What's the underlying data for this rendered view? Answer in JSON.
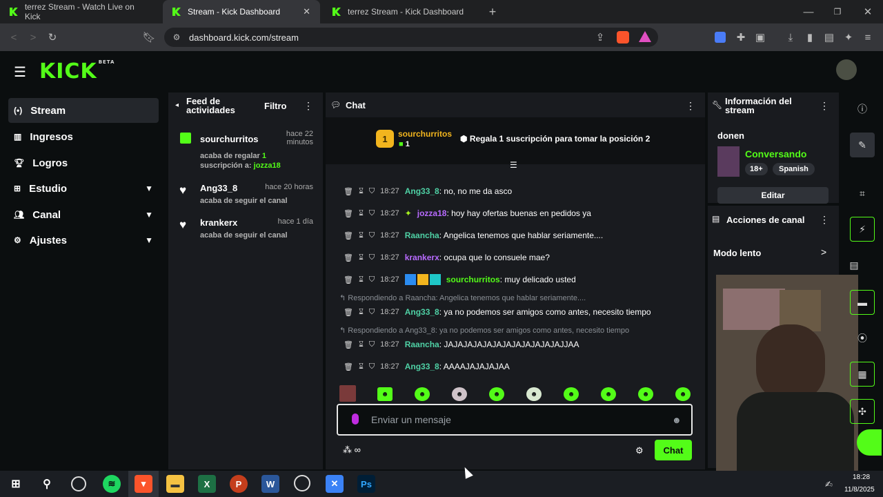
{
  "browser": {
    "tabs": [
      {
        "title": "terrez Stream - Watch Live on Kick"
      },
      {
        "title": "Stream - Kick Dashboard"
      },
      {
        "title": "terrez Stream - Kick Dashboard"
      }
    ],
    "url": "dashboard.kick.com/stream"
  },
  "app": {
    "logo": "KICK",
    "logo_badge": "BETA"
  },
  "sidebar": {
    "items": [
      {
        "label": "Stream",
        "icon": "broadcast-icon"
      },
      {
        "label": "Ingresos",
        "icon": "chart-icon"
      },
      {
        "label": "Logros",
        "icon": "trophy-icon"
      },
      {
        "label": "Estudio",
        "icon": "studio-icon"
      },
      {
        "label": "Canal",
        "icon": "users-icon"
      },
      {
        "label": "Ajustes",
        "icon": "gear-icon"
      }
    ]
  },
  "feed": {
    "title": "Feed de actividades",
    "filter": "Filtro",
    "items": [
      {
        "user": "sourchurritos",
        "time": "hace 22 minutos",
        "text": "acaba de regalar",
        "count": "1",
        "text2": "suscripción a:",
        "target": "jozza18"
      },
      {
        "user": "Ang33_8",
        "time": "hace 20 horas",
        "text": "acaba de seguir el canal"
      },
      {
        "user": "krankerx",
        "time": "hace 1 día",
        "text": "acaba de seguir el canal"
      }
    ]
  },
  "chat": {
    "title": "Chat",
    "leader": {
      "user": "sourchurritos",
      "rank": "1",
      "subs": "1",
      "prompt": "Regala 1 suscripción para tomar la posición 2"
    },
    "messages": [
      {
        "time": "18:27",
        "user": "Ang33_8",
        "color": "#4fd1a5",
        "text": ": no, no me da asco"
      },
      {
        "time": "18:27",
        "user": "jozza18",
        "color": "#b86bff",
        "text": ": hoy hay ofertas buenas en pedidos ya"
      },
      {
        "time": "18:27",
        "user": "Raancha",
        "color": "#4fd1a5",
        "text": ": Angelica tenemos que hablar seriamente...."
      },
      {
        "time": "18:27",
        "user": "krankerx",
        "color": "#b86bff",
        "text": ": ocupa que lo consuele mae?"
      },
      {
        "time": "18:27",
        "user": "sourchurritos",
        "color": "#53fc18",
        "text": ": muy delicado usted"
      },
      {
        "time": "18:27",
        "user": "Ang33_8",
        "color": "#4fd1a5",
        "text": ": ya no podemos ser amigos como antes, necesito tiempo",
        "reply": "Respondiendo a Raancha: Angelica tenemos que hablar seriamente...."
      },
      {
        "time": "18:27",
        "user": "Raancha",
        "color": "#4fd1a5",
        "text": ": JAJAJAJAJAJAJAJAJAJAJAJAJJAA",
        "reply": "Respondiendo a Ang33_8: ya no podemos ser amigos como antes, necesito tiempo"
      },
      {
        "time": "18:27",
        "user": "Ang33_8",
        "color": "#4fd1a5",
        "text": ": AAAAJAJAJAJAA"
      }
    ],
    "placeholder": "Enviar un mensaje",
    "send_label": "Chat"
  },
  "stream_info": {
    "title": "Información del stream",
    "stream_title": "donen",
    "category": "Conversando",
    "tags": [
      "18+",
      "Spanish"
    ],
    "edit_label": "Editar"
  },
  "channel_actions": {
    "title": "Acciones de canal",
    "slow_mode": "Modo lento"
  },
  "taskbar": {
    "time": "18:28",
    "date": "11/8/2025"
  },
  "colors": {
    "accent": "#53fc18",
    "panel": "#191b1f",
    "background": "#0b0e0f"
  }
}
